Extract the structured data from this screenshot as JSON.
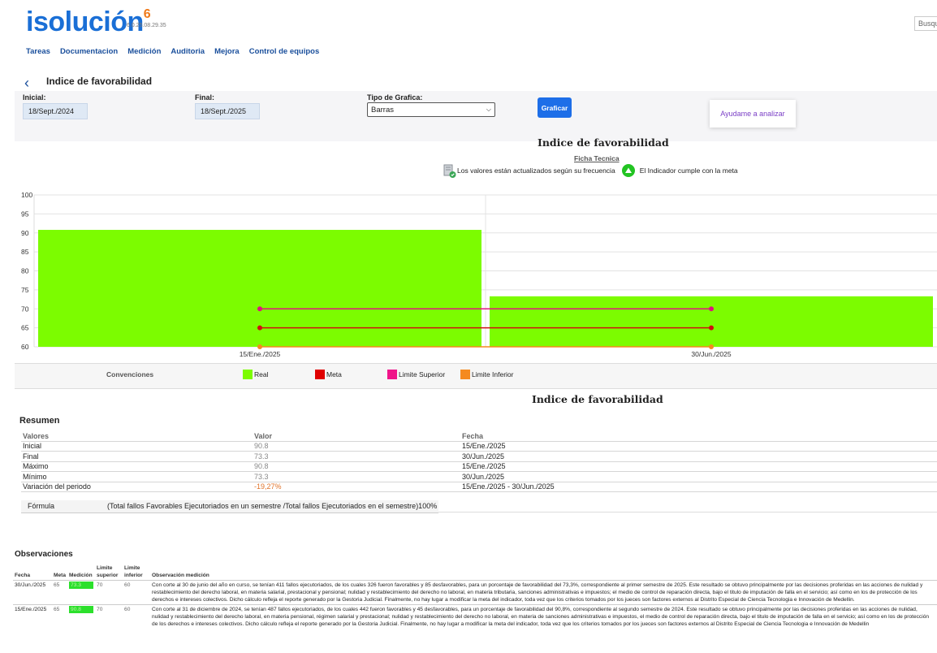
{
  "app": {
    "logo": "isolución",
    "logo_sup": "6",
    "version": "6.0.25.08.29.35",
    "search_text": "Busqu"
  },
  "nav": [
    "Tareas",
    "Documentacion",
    "Medición",
    "Auditoria",
    "Mejora",
    "Control de equipos"
  ],
  "page": {
    "back_icon": "chevron-left-icon",
    "title": "Indice de favorabilidad"
  },
  "filters": {
    "inicial_label": "Inicial:",
    "inicial_value": "18/Sept./2024",
    "final_label": "Final:",
    "final_value": "18/Sept./2025",
    "tipo_label": "Tipo de Grafica:",
    "tipo_value": "Barras",
    "graficar_button": "Graficar",
    "ayuda_button": "Ayudame a analizar"
  },
  "chart_header": {
    "title": "Indice de favorabilidad",
    "ficha_link": "Ficha Tecnica",
    "status_updated": "Los valores están actualizados según su frecuencia",
    "status_meta": "El Indicador cumple con la meta"
  },
  "chart_data": {
    "type": "bar",
    "categories": [
      "15/Ene./2025",
      "30/Jun./2025"
    ],
    "series": [
      {
        "name": "Real",
        "values": [
          90.8,
          73.3
        ],
        "color": "#7cfc00"
      },
      {
        "name": "Meta",
        "values": [
          65,
          65
        ],
        "color": "#d01010"
      },
      {
        "name": "Limite Superior",
        "values": [
          70,
          70
        ],
        "color": "#e0157e"
      },
      {
        "name": "Limite Inferior",
        "values": [
          60,
          60
        ],
        "color": "#f58a1f"
      }
    ],
    "ylim": [
      60,
      100
    ],
    "yticks": [
      60,
      65,
      70,
      75,
      80,
      85,
      90,
      95,
      100
    ],
    "grid": true
  },
  "legend": {
    "title": "Convenciones",
    "items": [
      {
        "label": "Real",
        "color": "#7cfc00"
      },
      {
        "label": "Meta",
        "color": "#e00000"
      },
      {
        "label": "Limite Superior",
        "color": "#f0158a"
      },
      {
        "label": "Limite Inferior",
        "color": "#f58a1f"
      }
    ]
  },
  "summary": {
    "title": "Indice de favorabilidad",
    "heading": "Resumen",
    "headers": [
      "Valores",
      "Valor",
      "Fecha"
    ],
    "rows": [
      [
        "Inicial",
        "90.8",
        "15/Ene./2025"
      ],
      [
        "Final",
        "73.3",
        "30/Jun./2025"
      ],
      [
        "Máximo",
        "90.8",
        "15/Ene./2025"
      ],
      [
        "Mínimo",
        "73.3",
        "30/Jun./2025"
      ],
      [
        "Variación del periodo",
        "-19,27%",
        "15/Ene./2025 - 30/Jun./2025"
      ]
    ],
    "formula_label": "Fórmula",
    "formula": "(Total fallos Favorables Ejecutoriados en un semestre /Total fallos Ejecutoriados en el semestre)100%"
  },
  "observations": {
    "heading": "Observaciones",
    "headers": [
      "Fecha",
      "Meta",
      "Medición",
      "Limite superior",
      "Limite inferior",
      "Observación medición"
    ],
    "rows": [
      {
        "fecha": "30/Jun./2025",
        "meta": "65",
        "medicion": "73.3",
        "sup": "70",
        "inf": "60",
        "obs": "Con corte al 30 de junio del año en curso, se tenían 411 fallos ejecutoriados, de los cuales 326 fueron favorables y 85 desfavorables, para un porcentaje de favorabilidad del 73,3%, correspondiente al primer semestre de 2025. Este resultado se obtuvo principalmente por las decisiones proferidas en las acciones de nulidad y restablecimiento del derecho laboral, en materia salarial, prestacional y pensional; nulidad y restablecimiento del derecho no laboral, en materia tributaria, sanciones administrativas e impuestos; el medio de control de reparación directa, bajo el titulo de imputación de falla en el servicio; así como en los de protección de los derechos e intereses colectivos. Dicho cálculo refleja el reporte generado por la Gestoria Judicial. Finalmente, no hay lugar a modificar la meta del indicador, toda vez que los criterios tomados por los jueces son factores externos al Distrito Especial de Ciencia Tecnologia e Innovación de Medellin."
      },
      {
        "fecha": "15/Ene./2025",
        "meta": "65",
        "medicion": "90.8",
        "sup": "70",
        "inf": "60",
        "obs": "Con corte al 31 de diciembre de 2024, se tenían 487 fallos ejecutoriados, de los cuales 442 fueron favorables y 45 desfavorables, para un porcentaje de favorabilidad del 90,8%, correspondiente al segundo semestre de 2024. Este resultado se obtuvo principalmente por las decisiones proferidas en las acciones de nulidad, nulidad y restablecimiento del derecho laboral, en materia pensional, régimen salarial y prestacional; nulidad y restablecimiento del derecho no laboral, en materia de sanciones administrativas e impuestos, el medio de control de reparación directa, bajo el titulo de imputación de falla en el servicio; así como en los de protección de los derechos e intereses colectivos. Dicho cálculo refleja el reporte generado por la Gestoria Judicial. Finalmente, no hay lugar a modificar la meta del indicador, toda vez que los criterios tomados por los jueces son factores externos al Distrito Especial de Ciencia Tecnologia e Innovación de Medellin"
      }
    ]
  }
}
